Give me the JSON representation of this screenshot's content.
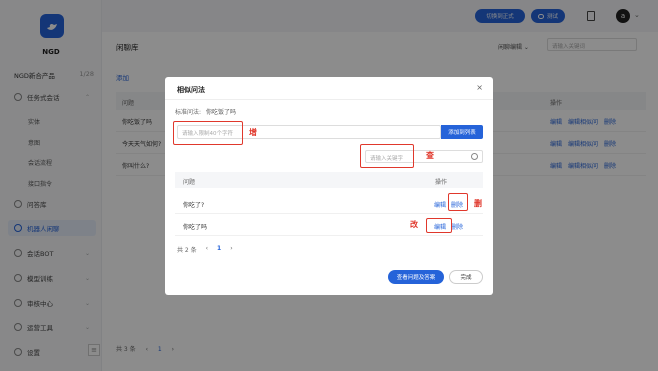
{
  "sidebar": {
    "logo_text": "NGD",
    "product": "NGD新合产品",
    "product_count": "1/28",
    "items": [
      {
        "label": "任务式会话"
      },
      {
        "label": "实体"
      },
      {
        "label": "意图"
      },
      {
        "label": "会话流程"
      },
      {
        "label": "接口指令"
      },
      {
        "label": "问答库"
      },
      {
        "label": "机器人闲聊"
      },
      {
        "label": "会话BOT"
      },
      {
        "label": "模型训练"
      },
      {
        "label": "审核中心"
      },
      {
        "label": "运营工具"
      },
      {
        "label": "设置"
      }
    ],
    "collapse": "≡"
  },
  "topbar": {
    "switch_btn": "切换到正式",
    "test_btn": "测试",
    "avatar": "a"
  },
  "main": {
    "title": "闲聊库",
    "filter": "闲聊编辑",
    "search_placeholder": "请输入关键词",
    "add": "添加",
    "col_question": "问题",
    "col_ops": "操作",
    "rows": [
      {
        "q": "你吃饭了吗",
        "edit": "编辑",
        "edit_similar": "编辑相似问",
        "del": "删除"
      },
      {
        "q": "今天天气如何?",
        "edit": "编辑",
        "edit_similar": "编辑相似问",
        "del": "删除"
      },
      {
        "q": "你叫什么?",
        "edit": "编辑",
        "edit_similar": "编辑相似问",
        "del": "删除"
      }
    ],
    "pager": {
      "total": "共 3 条",
      "prev": "‹",
      "page": "1",
      "next": "›"
    }
  },
  "modal": {
    "title": "相似问法",
    "close": "×",
    "std_label": "标准问法:",
    "std_value": "你吃饭了吗",
    "add_placeholder": "请输入限制40个字符",
    "add_btn": "添加到列表",
    "kw_placeholder": "请输入关键字",
    "col_question": "问题",
    "col_ops": "操作",
    "rows": [
      {
        "q": "你吃了?",
        "edit": "编辑",
        "del": "删除"
      },
      {
        "q": "你吃了吗",
        "edit": "编辑",
        "del": "删除"
      }
    ],
    "pager": {
      "total": "共 2 条",
      "prev": "‹",
      "page": "1",
      "next": "›"
    },
    "view_btn": "查看问题及答案",
    "done_btn": "完成"
  },
  "annotations": {
    "add": "增",
    "search": "查",
    "delete": "删",
    "edit": "改"
  },
  "colors": {
    "accent": "#2563d9",
    "annotation": "#e0382c"
  }
}
